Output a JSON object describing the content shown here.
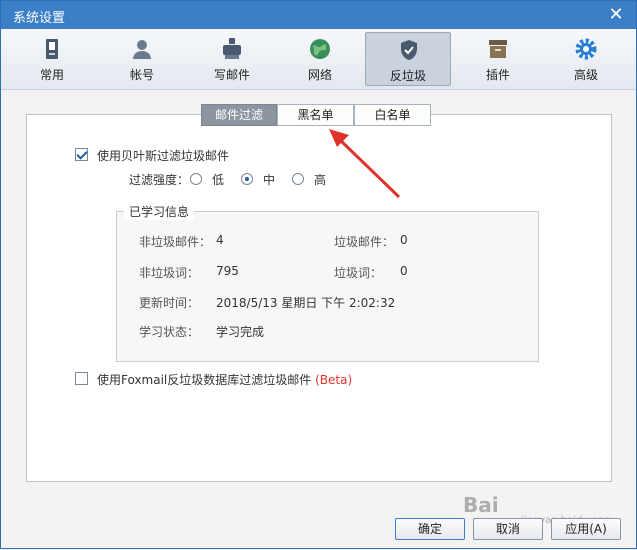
{
  "window": {
    "title": "系统设置"
  },
  "toolbar": {
    "items": [
      {
        "label": "常用",
        "icon": "general-icon"
      },
      {
        "label": "帐号",
        "icon": "account-icon"
      },
      {
        "label": "写邮件",
        "icon": "compose-icon"
      },
      {
        "label": "网络",
        "icon": "network-icon"
      },
      {
        "label": "反垃圾",
        "icon": "antispam-shield-icon",
        "active": true
      },
      {
        "label": "插件",
        "icon": "plugin-icon"
      },
      {
        "label": "高级",
        "icon": "advanced-gear-icon"
      }
    ]
  },
  "subtabs": [
    "邮件过滤",
    "黑名单",
    "白名单"
  ],
  "bayes": {
    "checkbox_label": "使用贝叶斯过滤垃圾邮件",
    "checked": true,
    "strength_label": "过滤强度：",
    "options": [
      "低",
      "中",
      "高"
    ],
    "selected": "中"
  },
  "learned": {
    "legend": "已学习信息",
    "rows": [
      {
        "l1": "非垃圾邮件：",
        "v1": "4",
        "l2": "垃圾邮件：",
        "v2": "0"
      },
      {
        "l1": "非垃圾词：",
        "v1": "795",
        "l2": "垃圾词：",
        "v2": "0"
      }
    ],
    "update_label": "更新时间：",
    "update_value": "2018/5/13 星期日 下午 2:02:32",
    "status_label": "学习状态：",
    "status_value": "学习完成"
  },
  "foxmail_db": {
    "checkbox_label": "使用Foxmail反垃圾数据库过滤垃圾邮件",
    "beta": "(Beta)",
    "checked": false
  },
  "buttons": {
    "ok": "确定",
    "cancel": "取消",
    "apply": "应用(A)"
  },
  "watermark": {
    "text": "Bai",
    "sub": "jingyan.baidu.com"
  },
  "colors": {
    "titlebar": "#3b7fc8",
    "arrow": "#e0322b",
    "active_tab": "#8d96a0"
  }
}
